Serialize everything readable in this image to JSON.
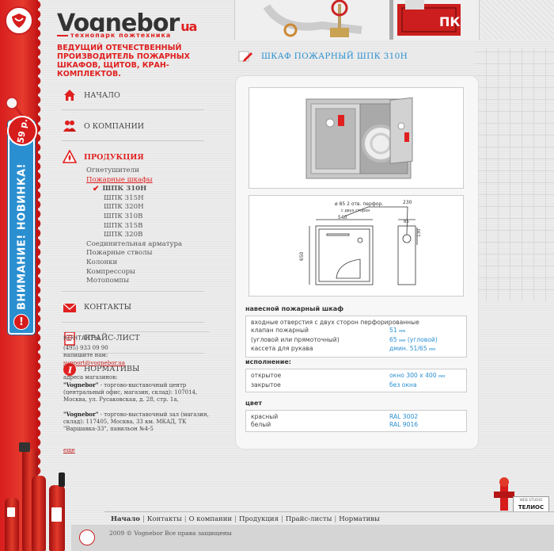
{
  "brand": {
    "name": "Vognebor",
    "tld": "ua",
    "slogan": "технопарк пожтехника"
  },
  "tagline": "ВЕДУЩИЙ ОТЕЧЕСТВЕННЫЙ ПРОИЗВОДИТЕЛЬ ПОЖАРНЫХ ШКАФОВ, ЩИТОВ, КРАН-КОМПЛЕКТОВ.",
  "sticker": {
    "price": "59 р.",
    "text": "ВНИМАНИЕ! НОВИНКА!",
    "warn": "!"
  },
  "nav": {
    "home": "НАЧАЛО",
    "about": "О КОМПАНИИ",
    "products": "ПРОДУКЦИЯ",
    "contacts": "КОНТАКТЫ",
    "pricelist": "ПРАЙС-ЛИСТ",
    "norms": "НОРМАТИВЫ"
  },
  "submenu": {
    "extinguishers": "Огнетушители",
    "cabinets": "Пожарные шкафы",
    "current": "ШПК 310Н",
    "items": [
      "ШПК 315Н",
      "ШПК 320Н",
      "ШПК 310В",
      "ШПК 315В",
      "ШПК 320В"
    ],
    "after": [
      "Соединительная арматура",
      "Пожарные стволы",
      "Колонки",
      "Компрессоры",
      "Мотопомпы"
    ]
  },
  "contacts": {
    "title": "КОНТАКТЫ",
    "phone": "(495) 933 09 90",
    "write": "напишите нам:",
    "email": "support@vognebor.ua",
    "addr_title": "адреса магазинов:",
    "addr1_name": "\"Vognebor\"",
    "addr1_text": " - торгово-выставочный центр (центральный офис, магазин, склад): 107014, Москва, ул. Русаковская, д. 28, стр. 1а,",
    "addr2_name": "\"Vognebor\"",
    "addr2_text": " - торгово-выставочный зал (магазин, склад): 117405, Москва, 33 км. МКАД, ТК \"Варшавка-33\", павильон №4-5",
    "more": "еще"
  },
  "page_title": "ШКАФ ПОЖАРНЫЙ ШПК 310Н",
  "drawing": {
    "d1": "ø 85 2 отв. перфор.",
    "d1b": "с двух сторон",
    "w": "540",
    "h": "650",
    "dside": "230",
    "d85": "85",
    "d130": "130"
  },
  "specs": {
    "mount_title": "навесной пожарный шкаф",
    "inlets": "входные отверстия с двух сторон перфорированные",
    "valve_k": "клапан пожарный",
    "valve_v": "51",
    "valve_k2": "(угловой или прямоточный)",
    "valve_v2": "65",
    "valve_v2_note": "(угловой)",
    "hose_k": "кассета для рукава",
    "hose_v": "дмин. 51/65",
    "unit_mm": "мм",
    "exec_title": "исполнение:",
    "open_k": "открытое",
    "open_v": "окно 300 х 400",
    "closed_k": "закрытое",
    "closed_v": "без окна",
    "color_title": "цвет",
    "red_k": "красный",
    "red_v": "RAL 3002",
    "white_k": "белый",
    "white_v": "RAL 9016"
  },
  "footer": {
    "links": [
      "Начало",
      "Контакты",
      "О компании",
      "Продукция",
      "Прайс-листы",
      "Нормативы"
    ],
    "copy": "2009 © Vognebor Все права защищены",
    "studio": "ТЕЛИОС",
    "studio_small": "WEB STUDIO"
  },
  "colors": {
    "accent_red": "#e02020",
    "link_blue": "#2a8fd0"
  }
}
